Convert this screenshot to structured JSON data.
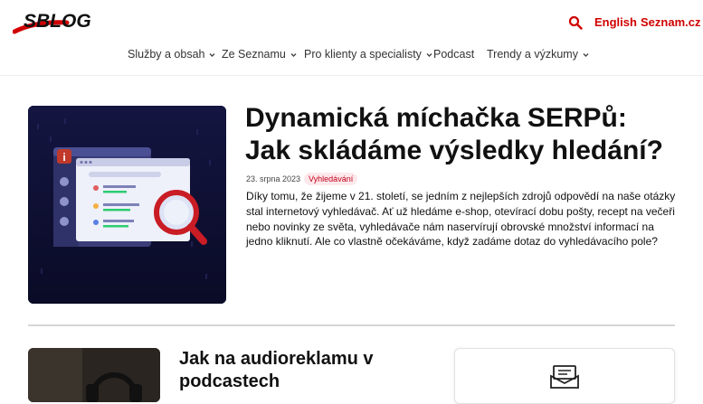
{
  "header": {
    "logo_text": "SBLOG",
    "lang_link": "English",
    "site_link": "Seznam.cz",
    "search_icon": "search-icon"
  },
  "nav": {
    "items": [
      {
        "label": "Služby a obsah",
        "has_dropdown": true
      },
      {
        "label": "Ze Seznamu",
        "has_dropdown": true
      },
      {
        "label": "Pro klienty a specialisty",
        "has_dropdown": true
      },
      {
        "label": "Podcast",
        "has_dropdown": false
      },
      {
        "label": "Trendy a výzkumy",
        "has_dropdown": true
      }
    ]
  },
  "featured": {
    "title": "Dynamická míchačka SERPů: Jak skládáme výsledky hledání?",
    "date": "23. srpna 2023",
    "tag": "Vyhledávání",
    "excerpt": "Díky tomu, že žijeme v 21. století, se jedním z nejlepších zdrojů odpovědí na naše otázky stal internetový vyhledávač. Ať už hledáme e-shop, otevírací dobu pošty, recept na večeři nebo novinky ze světa, vyhledávače nám naservírují obrovské množství informací na jedno kliknutí. Ale co vlastně očekáváme, když zadáme dotaz do vyhledávacího pole?"
  },
  "second": {
    "title": "Jak na audioreklamu v podcastech"
  },
  "colors": {
    "brand_red": "#d00000",
    "tag_bg": "#fde9ec",
    "featured_bg": "#0f1035"
  }
}
